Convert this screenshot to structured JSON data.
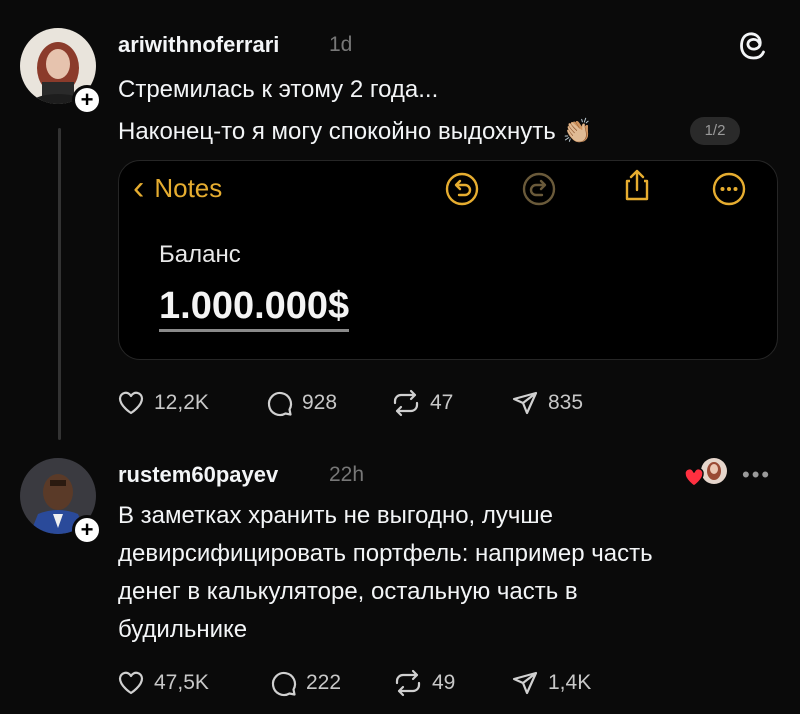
{
  "post1": {
    "username": "ariwithnoferrari",
    "time": "1d",
    "line1": "Стремилась к этому 2 года...",
    "line2": "Наконец-то я могу спокойно выдохнуть 👏🏼",
    "page_indicator": "1/2",
    "embed": {
      "back_label": "Notes",
      "balance_label": "Баланс",
      "balance_value": "1.000.000$",
      "accent_color": "#e6ad30"
    },
    "stats": {
      "likes": "12,2K",
      "replies": "928",
      "reposts": "47",
      "shares": "835"
    }
  },
  "post2": {
    "username": "rustem60payev",
    "time": "22h",
    "line1": "В заметках хранить не выгодно, лучше",
    "line2": "девирсифицировать портфель: например часть",
    "line3": "денег в калькуляторе, остальную часть в",
    "line4": "будильнике",
    "stats": {
      "likes": "47,5K",
      "replies": "222",
      "reposts": "49",
      "shares": "1,4K"
    }
  },
  "icons": {
    "threads_logo": "threads-icon",
    "like": "heart-icon",
    "reply": "speech-bubble-icon",
    "repost": "repost-icon",
    "share": "paper-plane-icon",
    "more": "more-dots-icon"
  }
}
